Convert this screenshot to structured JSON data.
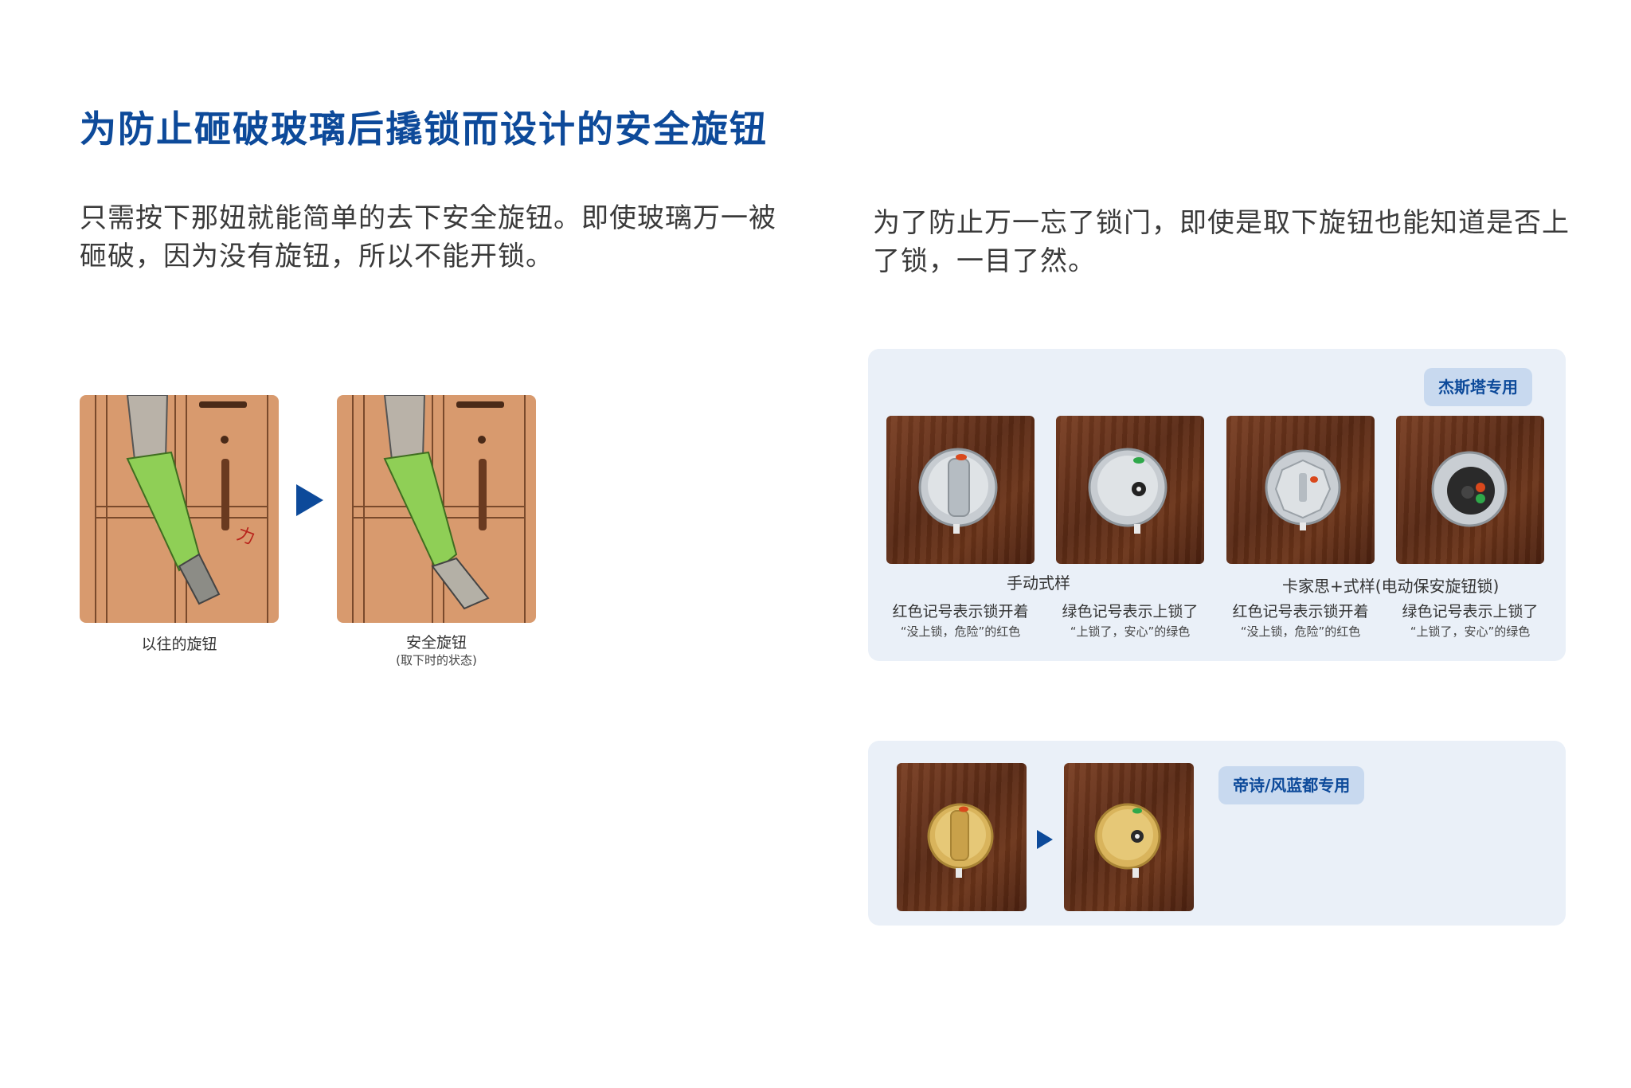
{
  "title": "为防止砸破玻璃后撬锁而设计的安全旋钮",
  "intro_left": "只需按下那妞就能简单的去下安全旋钮。即使玻璃万一被砸破，因为没有旋钮，所以不能开锁。",
  "intro_right": "为了防止万一忘了锁门，即使是取下旋钮也能知道是否上了锁，一目了然。",
  "illustration": {
    "left_caption": "以往的旋钮",
    "right_caption": "安全旋钮",
    "right_subcaption": "(取下时的状态)"
  },
  "panel1": {
    "badge": "杰斯塔专用",
    "group_manual": "手动式样",
    "group_electric": "卡家思+式样(电动保安旋钮锁)",
    "items": [
      {
        "line1": "红色记号表示锁开着",
        "line2": "“没上锁，危险”的红色"
      },
      {
        "line1": "绿色记号表示上锁了",
        "line2": "“上锁了，安心”的绿色"
      },
      {
        "line1": "红色记号表示锁开着",
        "line2": "“没上锁，危险”的红色"
      },
      {
        "line1": "绿色记号表示上锁了",
        "line2": "“上锁了，安心”的绿色"
      }
    ]
  },
  "panel2": {
    "badge": "帝诗/风蓝都专用"
  },
  "colors": {
    "title": "#0d4a9a",
    "panel_bg": "#eaf0f8",
    "badge_bg": "#c8d9ef",
    "lock_red": "#d9481c",
    "lock_green": "#2fa84a"
  }
}
